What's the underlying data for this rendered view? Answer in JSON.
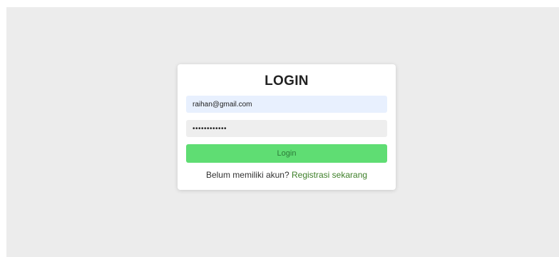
{
  "login": {
    "title": "LOGIN",
    "email_value": "raihan@gmail.com",
    "password_value": "************",
    "login_button_label": "Login",
    "register_prompt": "Belum memiliki akun?",
    "register_link_label": "Registrasi sekarang"
  },
  "colors": {
    "background": "#ececec",
    "card": "#ffffff",
    "email_field": "#e8f0fe",
    "password_field": "#eeeeee",
    "login_button": "#5fdd73",
    "link": "#3d7f28"
  }
}
